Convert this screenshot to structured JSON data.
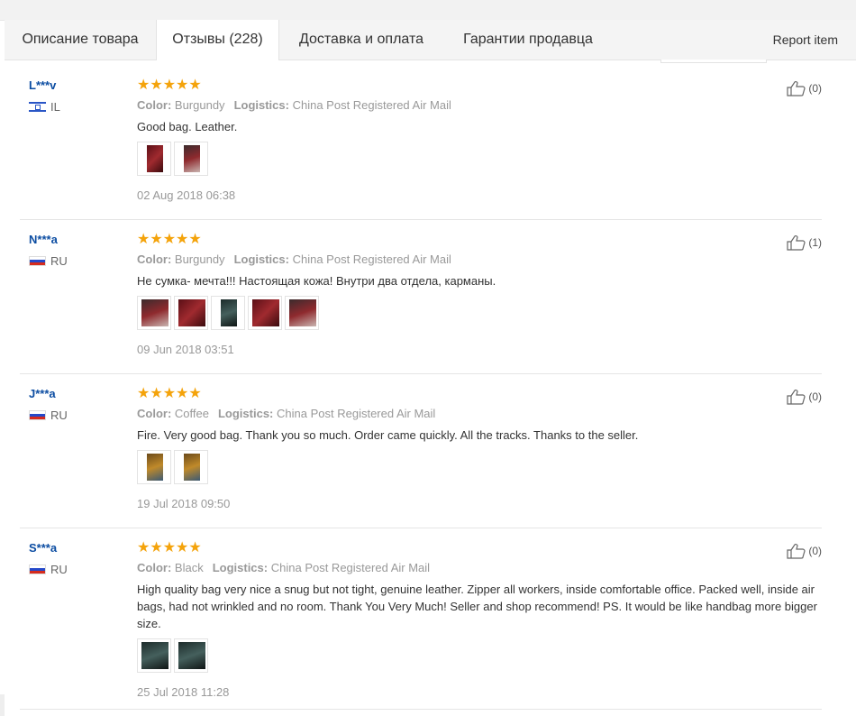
{
  "tabs": [
    {
      "label": "Описание товара",
      "active": false
    },
    {
      "label": "Отзывы (228)",
      "active": true
    },
    {
      "label": "Доставка и оплата",
      "active": false
    },
    {
      "label": "Гарантии продавца",
      "active": false
    }
  ],
  "report_label": "Report item",
  "labels": {
    "color": "Color:",
    "logistics": "Logistics:"
  },
  "reviews": [
    {
      "user": "L***v",
      "country": "IL",
      "stars": "★★★★★",
      "color": "Burgundy",
      "logistics": "China Post Registered Air Mail",
      "text": "Good bag. Leather.",
      "photo_count": 2,
      "date": "02 Aug 2018 06:38",
      "likes": "(0)"
    },
    {
      "user": "N***a",
      "country": "RU",
      "stars": "★★★★★",
      "color": "Burgundy",
      "logistics": "China Post Registered Air Mail",
      "text": "Не сумка- мечта!!! Настоящая кожа! Внутри два отдела, карманы.",
      "photo_count": 5,
      "date": "09 Jun 2018 03:51",
      "likes": "(1)"
    },
    {
      "user": "J***a",
      "country": "RU",
      "stars": "★★★★★",
      "color": "Coffee",
      "logistics": "China Post Registered Air Mail",
      "text": "Fire. Very good bag. Thank you so much. Order came quickly. All the tracks. Thanks to the seller.",
      "photo_count": 2,
      "date": "19 Jul 2018 09:50",
      "likes": "(0)"
    },
    {
      "user": "S***a",
      "country": "RU",
      "stars": "★★★★★",
      "color": "Black",
      "logistics": "China Post Registered Air Mail",
      "text": "High quality bag very nice a snug but not tight, genuine leather. Zipper all workers, inside comfortable office. Packed well, inside air bags, had not wrinkled and no room. Thank You Very Much! Seller and shop recommend! PS. It would be like handbag more bigger size.",
      "photo_count": 2,
      "date": "25 Jul 2018 11:28",
      "likes": "(0)"
    }
  ]
}
